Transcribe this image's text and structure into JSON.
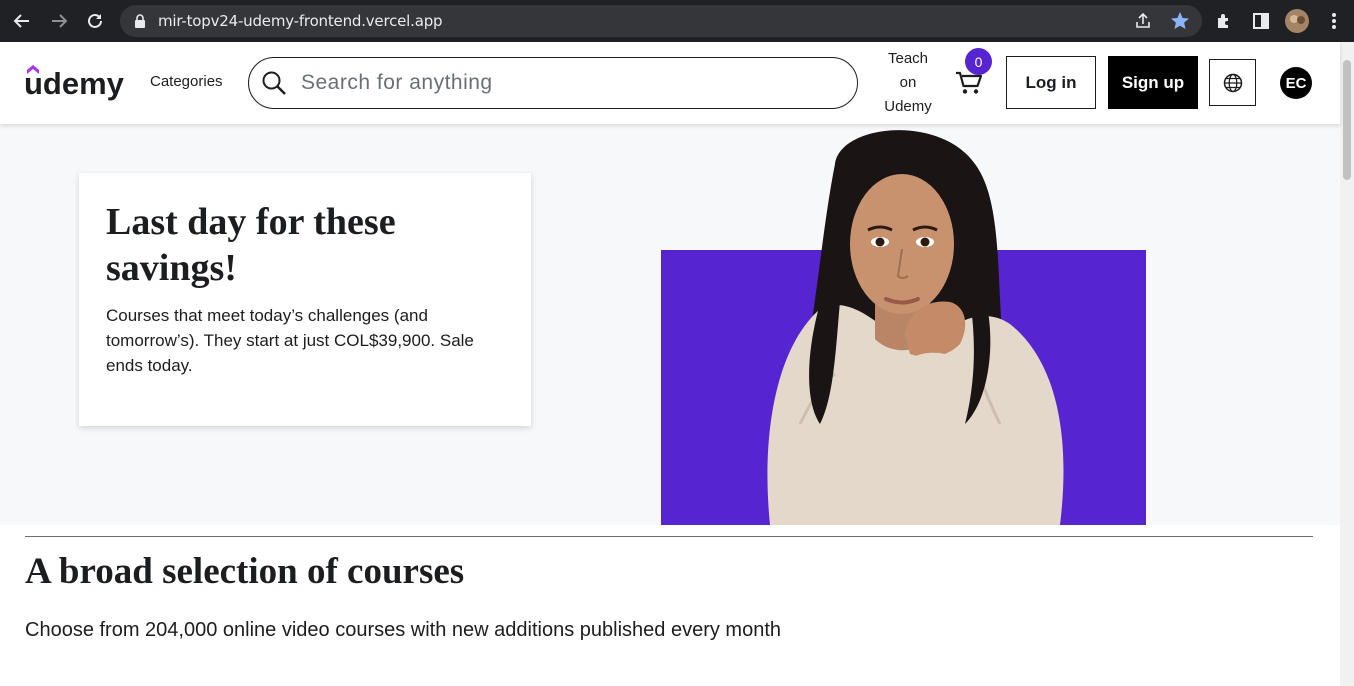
{
  "browser": {
    "url": "mir-topv24-udemy-frontend.vercel.app"
  },
  "header": {
    "logo_text": "udemy",
    "categories_label": "Categories",
    "search_placeholder": "Search for anything",
    "teach_line1": "Teach",
    "teach_line2": "on",
    "teach_line3": "Udemy",
    "cart_count": "0",
    "login_label": "Log in",
    "signup_label": "Sign up",
    "avatar_initials": "EC",
    "accent_color": "#5624d0"
  },
  "hero": {
    "title": "Last day for these savings!",
    "text": "Courses that meet today’s challenges (and tomorrow’s). They start at just COL$39,900. Sale ends today."
  },
  "section": {
    "title": "A broad selection of courses",
    "subtitle": "Choose from 204,000 online video courses with new additions published every month"
  }
}
